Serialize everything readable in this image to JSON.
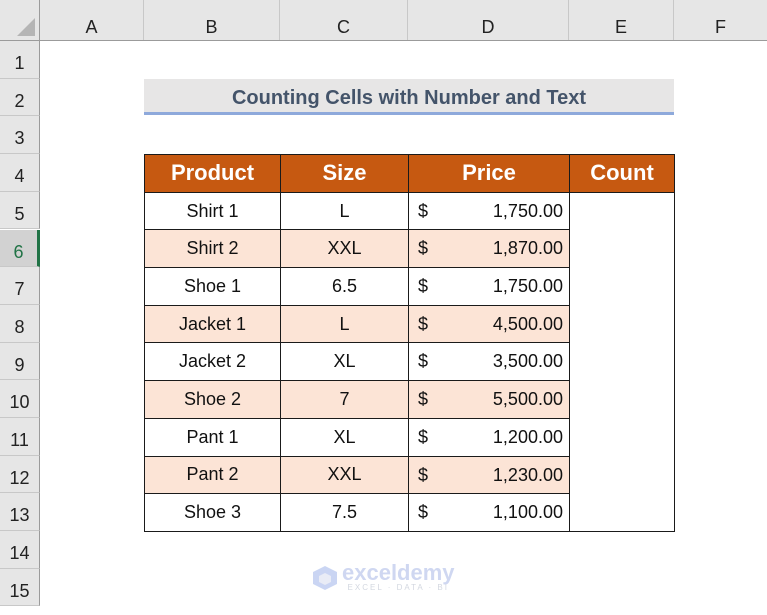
{
  "sheet": {
    "columns": [
      "A",
      "B",
      "C",
      "D",
      "E",
      "F"
    ],
    "rows": [
      "1",
      "2",
      "3",
      "4",
      "5",
      "6",
      "7",
      "8",
      "9",
      "10",
      "11",
      "12",
      "13",
      "14",
      "15"
    ],
    "selected_row": "6"
  },
  "title": "Counting Cells with Number and Text",
  "table": {
    "headers": [
      "Product",
      "Size",
      "Price",
      "Count"
    ],
    "currency_symbol": "$",
    "rows": [
      {
        "product": "Shirt 1",
        "size": "L",
        "price": "1,750.00"
      },
      {
        "product": "Shirt 2",
        "size": "XXL",
        "price": "1,870.00"
      },
      {
        "product": "Shoe 1",
        "size": "6.5",
        "price": "1,750.00"
      },
      {
        "product": "Jacket 1",
        "size": "L",
        "price": "4,500.00"
      },
      {
        "product": "Jacket 2",
        "size": "XL",
        "price": "3,500.00"
      },
      {
        "product": "Shoe 2",
        "size": "7",
        "price": "5,500.00"
      },
      {
        "product": "Pant 1",
        "size": "XL",
        "price": "1,200.00"
      },
      {
        "product": "Pant 2",
        "size": "XXL",
        "price": "1,230.00"
      },
      {
        "product": "Shoe 3",
        "size": "7.5",
        "price": "1,100.00"
      }
    ],
    "count_value": ""
  },
  "watermark": {
    "name": "exceldemy",
    "tagline": "EXCEL · DATA · BI"
  },
  "colors": {
    "header_fill": "#c65911",
    "alt_row_fill": "#fce4d6",
    "title_fill": "#e7e6e6",
    "title_underline": "#8ea9db",
    "selection": "#217346"
  }
}
